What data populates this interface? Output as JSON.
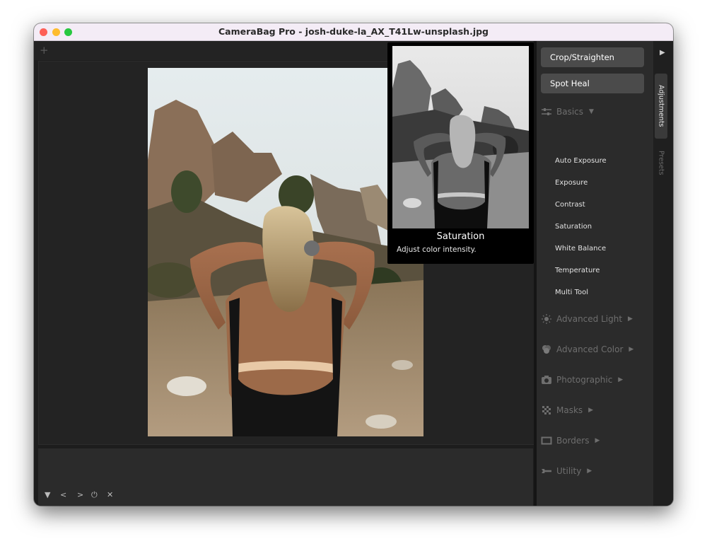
{
  "window": {
    "title": "CameraBag Pro - josh-duke-la_AX_T41Lw-unsplash.jpg"
  },
  "toolbar": {
    "add_icon": "+"
  },
  "sidebar": {
    "buttons": [
      {
        "label": "Crop/Straighten"
      },
      {
        "label": "Spot Heal"
      }
    ],
    "basics": {
      "label": "Basics",
      "items": [
        {
          "label": "Auto Exposure"
        },
        {
          "label": "Exposure"
        },
        {
          "label": "Contrast"
        },
        {
          "label": "Saturation"
        },
        {
          "label": "White Balance"
        },
        {
          "label": "Temperature"
        },
        {
          "label": "Multi Tool"
        }
      ]
    },
    "sections": [
      {
        "label": "Advanced Light",
        "icon": "sun-icon"
      },
      {
        "label": "Advanced Color",
        "icon": "color-drops-icon"
      },
      {
        "label": "Photographic",
        "icon": "camera-icon"
      },
      {
        "label": "Masks",
        "icon": "checker-icon"
      },
      {
        "label": "Borders",
        "icon": "frame-icon"
      },
      {
        "label": "Utility",
        "icon": "wrench-icon"
      }
    ]
  },
  "tabs": [
    {
      "label": "Adjustments"
    },
    {
      "label": "Presets"
    }
  ],
  "tooltip": {
    "title": "Saturation",
    "description": "Adjust color intensity."
  },
  "filmstrip_controls": {
    "down": "▼",
    "prev": "<",
    "next": ">",
    "power": "⏻",
    "close": "✕"
  }
}
